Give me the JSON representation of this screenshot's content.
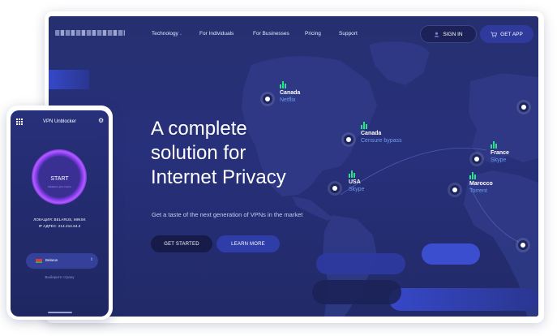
{
  "nav": {
    "items": [
      {
        "label": "Technology",
        "dropdown": true
      },
      {
        "label": "For Individuals",
        "dropdown": false
      },
      {
        "label": "For Businesses",
        "dropdown": false
      },
      {
        "label": "Pricing",
        "dropdown": false
      },
      {
        "label": "Support",
        "dropdown": false
      }
    ],
    "signin_label": "SIGN IN",
    "getapp_label": "GET APP"
  },
  "hero": {
    "title_lines": [
      "A complete",
      "solution for",
      "Internet Privacy"
    ],
    "subtitle": "Get a taste of the next generation of VPNs in the market",
    "cta_primary": "GET STARTED",
    "cta_secondary": "LEARN MORE"
  },
  "locations": [
    {
      "name": "Canada",
      "service": "Netflix",
      "signal": 3
    },
    {
      "name": "Canada",
      "service": "Censure bypass",
      "signal": 3
    },
    {
      "name": "USA",
      "service": "Skype",
      "signal": 3
    },
    {
      "name": "France",
      "service": "Skype",
      "signal": 3
    },
    {
      "name": "Marocco",
      "service": "Torrent",
      "signal": 3
    }
  ],
  "phone": {
    "app_title": "VPN Unblocker",
    "start_label": "START",
    "start_sub": "Нажмите для старта",
    "location_line": "ЛОКАЦИЯ: BELARUS, MINSK",
    "ip_line": "IP АДРЕС: 214.214.64.2",
    "country": "Belarus",
    "choose_label": "Выберите страну"
  },
  "colors": {
    "background": "#263070",
    "accent": "#2f3da8",
    "signal": "#2ee08a",
    "service_text": "#6e9cf0",
    "start_ring": "#b25cff"
  },
  "icons": {
    "signin": "user-icon",
    "getapp": "cart-icon",
    "menu": "grid-menu-icon",
    "settings": "gear-icon",
    "country_dropdown": "chevron-icon"
  }
}
